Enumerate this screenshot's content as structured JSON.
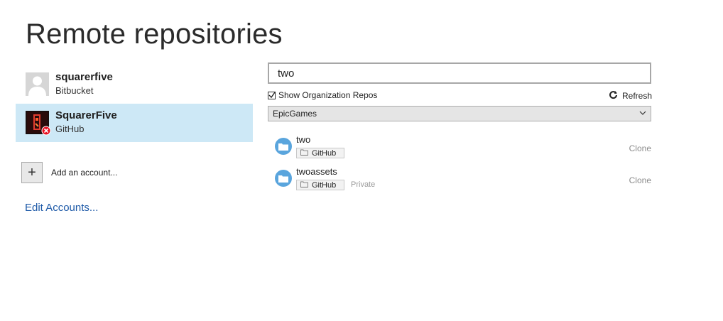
{
  "page": {
    "title": "Remote repositories"
  },
  "accounts": [
    {
      "name": "squarerfive",
      "type": "Bitbucket"
    },
    {
      "name": "SquarerFive",
      "type": "GitHub"
    }
  ],
  "add_account_label": "Add an account...",
  "edit_accounts_label": "Edit Accounts...",
  "search": {
    "value": "two"
  },
  "show_org_repos": {
    "label": "Show Organization Repos",
    "checked": true
  },
  "refresh_label": "Refresh",
  "organization_select": {
    "selected": "EpicGames"
  },
  "repos": [
    {
      "name": "two",
      "host": "GitHub",
      "private_label": "",
      "action": "Clone"
    },
    {
      "name": "twoassets",
      "host": "GitHub",
      "private_label": "Private",
      "action": "Clone"
    }
  ],
  "colors": {
    "accent_selected": "#cde8f6",
    "link": "#1e5aa8",
    "repo_icon": "#5aa5dd",
    "error_badge": "#e81123"
  }
}
